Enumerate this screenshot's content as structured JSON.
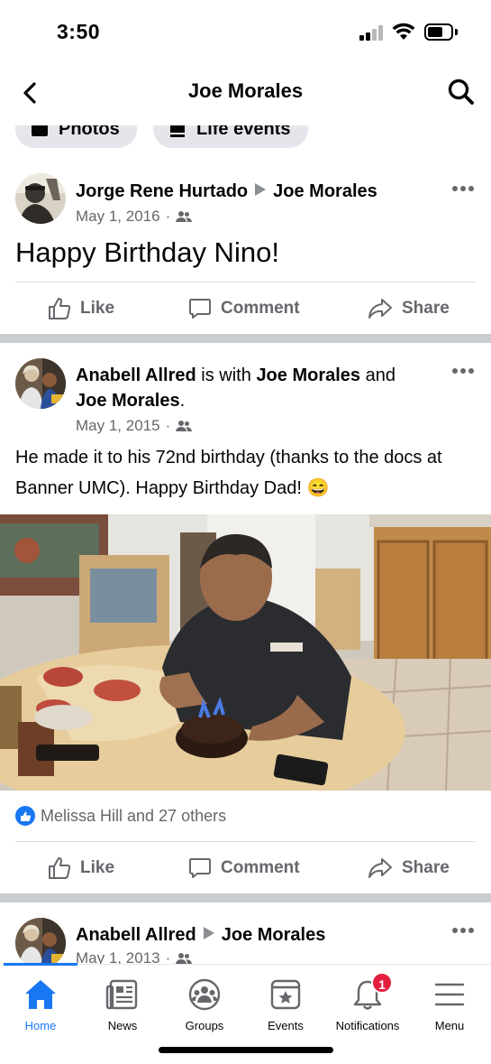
{
  "status_bar": {
    "time": "3:50"
  },
  "header": {
    "title": "Joe Morales"
  },
  "chips": [
    {
      "label": "Photos"
    },
    {
      "label": "Life events"
    }
  ],
  "posts": [
    {
      "author": "Jorge Rene Hurtado",
      "target": "Joe Morales",
      "date": "May 1, 2016",
      "dot": "·",
      "text": "Happy Birthday Nino!"
    },
    {
      "author": "Anabell Allred",
      "is_with": "is with",
      "tagged_1": "Joe Morales",
      "and": "and",
      "tagged_2": "Joe Morales",
      "period": ".",
      "date": "May 1, 2015",
      "dot": "·",
      "text": "He made it to his 72nd birthday (thanks to the docs at Banner UMC). Happy Birthday Dad! 😄",
      "reactions": "Melissa Hill and 27 others"
    },
    {
      "author": "Anabell Allred",
      "target": "Joe Morales",
      "date": "May 1, 2013",
      "dot": "·"
    }
  ],
  "actions": {
    "like": "Like",
    "comment": "Comment",
    "share": "Share"
  },
  "nav": [
    {
      "label": "Home",
      "icon": "home-icon",
      "active": true
    },
    {
      "label": "News",
      "icon": "news-icon"
    },
    {
      "label": "Groups",
      "icon": "groups-icon"
    },
    {
      "label": "Events",
      "icon": "events-icon"
    },
    {
      "label": "Notifications",
      "icon": "bell-icon",
      "badge": "1"
    },
    {
      "label": "Menu",
      "icon": "menu-icon"
    }
  ],
  "colors": {
    "brand": "#1877f2",
    "badge": "#e41e3f",
    "secondary_text": "#65676b"
  }
}
